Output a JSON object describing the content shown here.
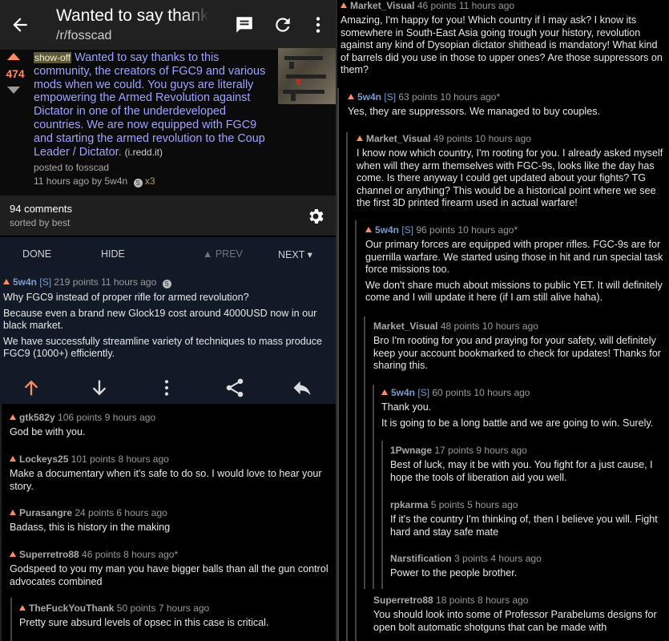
{
  "toolbar": {
    "title": "Wanted to say thanks to this community",
    "subreddit": "/r/fosscad"
  },
  "post": {
    "score": "474",
    "flair": "show-off",
    "title": "Wanted to say thanks to this community, the creators of FGC9 and various mods when we could. You guys are literally empowering the Armed Revolution against Dictator in one of the underdeveloped countries. We are now equipped with FGC9 and starting the armed revolution to the Coup Leader / Dictator.",
    "domain": "(i.redd.it)",
    "posted_to": "posted to fosscad",
    "time_author": "11 hours ago by 5w4n",
    "award_count": "x3"
  },
  "comments_header": {
    "count": "94 comments",
    "sort": "sorted by best"
  },
  "nav": {
    "done": "DONE",
    "hide": "HIDE",
    "prev": "▲ PREV",
    "next": "NEXT ▾"
  },
  "selected_comment": {
    "author": "5w4n",
    "op_tag": "[S]",
    "meta": "219 points 11 hours ago",
    "body": [
      "Why FGC9 instead of proper rifle for armed revolution?",
      "Because even a brand new Glock19 cost around 4000USD now in our black market.",
      "We have successfully streamline variety of techniques to mass produce FGC9 (1000+) efficiently."
    ]
  },
  "left_comments": [
    {
      "author": "gtk582y",
      "meta": "106 points 9 hours ago",
      "body": "God be with you."
    },
    {
      "author": "Lockeys25",
      "meta": "101 points 8 hours ago",
      "body": "Make a documentary when it's safe to do so. I would love to hear your story."
    },
    {
      "author": "Purasangre",
      "meta": "24 points 6 hours ago",
      "body": "Badass, this is history in the making"
    },
    {
      "author": "Superretro88",
      "meta": "46 points 8 hours ago*",
      "body": "Godspeed to you my man you have bigger balls than all the gun control advocates combined"
    },
    {
      "author": "TheFuckYouThank",
      "meta": "50 points 7 hours ago",
      "body": "Pretty sure absurd levels of opsec in this case is critical."
    }
  ],
  "right_comments": [
    {
      "author": "Market_Visual",
      "op": "",
      "meta": "46 points 11 hours ago",
      "body": [
        "Amazing, I'm happy for you! Which country if I may ask? I know its somewhere in South-East Asia going trough your history, revolution against any kind of Dysopian dictator shithead is mandatory! What kind of barrels did you use in those to upper ones? Are those suppressors on them?"
      ]
    },
    {
      "author": "5w4n",
      "op": "[S]",
      "meta": "63 points 10 hours ago*",
      "body": [
        "Yes, they are suppressors. We managed to buy couples."
      ]
    },
    {
      "author": "Market_Visual",
      "op": "",
      "meta": "49 points 10 hours ago",
      "body": [
        "I know now which country, I'm rooting for you. I already asked myself when will they arm themselves with FGC-9s, looks like the day has come. Is there anyway I could get updated about your fights? TG channel or anything? This would be a historical point where we see the first 3D printed firearm used in actual warfare!"
      ]
    },
    {
      "author": "5w4n",
      "op": "[S]",
      "meta": "96 points 10 hours ago*",
      "body": [
        "Our primary forces are equipped with proper rifles. FGC-9s are for guerrilla warfare. We started using those in hit and run special task force missions too.",
        "We don't share much about missions to public YET. It will definitely come and I will update it here (if I am still alive haha)."
      ]
    },
    {
      "author": "Market_Visual",
      "op": "",
      "meta": "48 points 10 hours ago",
      "body": [
        "Bro I'm rooting for you and praying for your safety, will definitely keep your account bookmarked to check for updates! Thanks for sharing this."
      ]
    },
    {
      "author": "5w4n",
      "op": "[S]",
      "meta": "60 points 10 hours ago",
      "body": [
        "Thank you.",
        "It is going to be a long battle and we are going to win. Surely."
      ]
    },
    {
      "author": "1Pwnage",
      "op": "",
      "meta": "17 points 9 hours ago",
      "body": [
        "Best of luck, may it be with you. You fight for a just cause, I hope the tools of liberation aid you well."
      ]
    },
    {
      "author": "rpkarma",
      "op": "",
      "meta": "5 points 5 hours ago",
      "body": [
        "If it's the country I'm thinking of, then I believe you will. Fight hard and stay safe mate"
      ]
    },
    {
      "author": "Narstification",
      "op": "",
      "meta": "3 points 4 hours ago",
      "body": [
        "Power to the people brother."
      ]
    },
    {
      "author": "Superretro88",
      "op": "",
      "meta": "18 points 8 hours ago",
      "body": [
        "You should look into some of Professor Parabelums designs for open bolt automatic shotguns that can be made with"
      ]
    }
  ],
  "colors": {
    "upvote": "#ff8b60",
    "link": "#9fa3ff",
    "op": "#7f9ac8",
    "selected_bg": "#111a26"
  }
}
